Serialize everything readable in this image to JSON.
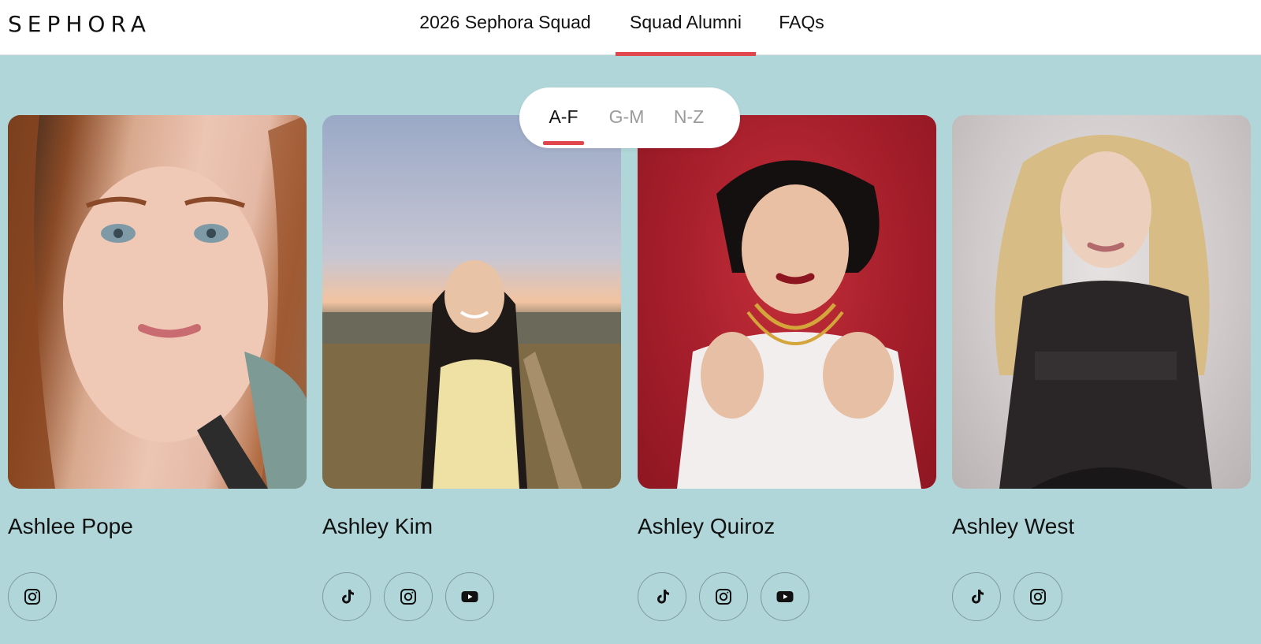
{
  "brand": {
    "logo_text": "SEPHORA"
  },
  "nav": {
    "tabs": [
      {
        "label": "2026 Sephora Squad",
        "active": false
      },
      {
        "label": "Squad Alumni",
        "active": true
      },
      {
        "label": "FAQs",
        "active": false
      }
    ]
  },
  "filter": {
    "options": [
      {
        "label": "A-F",
        "active": true
      },
      {
        "label": "G-M",
        "active": false
      },
      {
        "label": "N-Z",
        "active": false
      }
    ]
  },
  "colors": {
    "accent": "#e0464c",
    "background": "#b0d6d9",
    "header": "#ffffff"
  },
  "members": [
    {
      "name": "Ashlee Pope",
      "socials": [
        "instagram-icon"
      ]
    },
    {
      "name": "Ashley Kim",
      "socials": [
        "tiktok-icon",
        "instagram-icon",
        "youtube-icon"
      ]
    },
    {
      "name": "Ashley Quiroz",
      "socials": [
        "tiktok-icon",
        "instagram-icon",
        "youtube-icon"
      ]
    },
    {
      "name": "Ashley West",
      "socials": [
        "tiktok-icon",
        "instagram-icon"
      ]
    }
  ]
}
